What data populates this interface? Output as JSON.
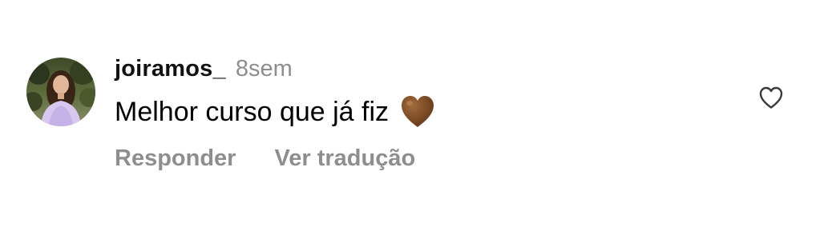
{
  "comment": {
    "username": "joiramos_",
    "timestamp": "8sem",
    "text": "Melhor curso que já fiz",
    "emoji": "brown-heart-icon",
    "actions": {
      "reply_label": "Responder",
      "translate_label": "Ver tradução"
    },
    "like_icon": "heart-outline-icon"
  },
  "colors": {
    "username": "#111111",
    "secondary_text": "#8e8e8e",
    "brown_heart": "#7b4a24"
  }
}
